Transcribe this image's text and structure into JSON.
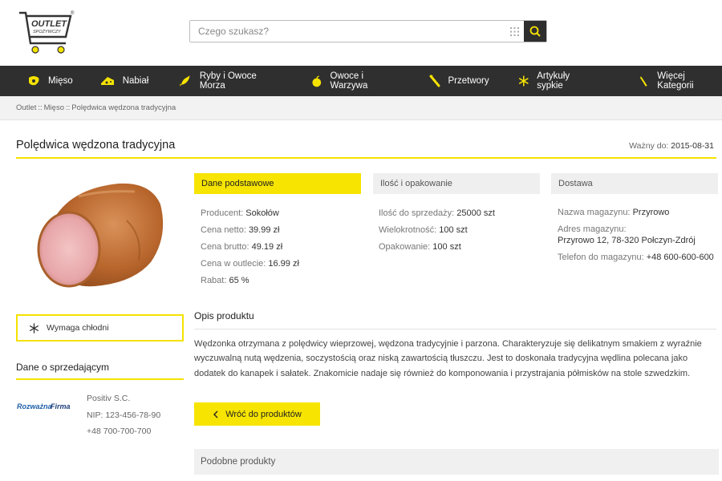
{
  "header": {
    "logo_line1": "OUTLET",
    "logo_line2": "SPOŻYWCZY",
    "logo_reg": "®",
    "search": {
      "placeholder": "Czego szukasz?"
    }
  },
  "nav": {
    "items": [
      {
        "label": "Mięso",
        "icon": "meat-icon"
      },
      {
        "label": "Nabiał",
        "icon": "cheese-icon"
      },
      {
        "label": "Ryby i Owoce Morza",
        "icon": "fish-icon"
      },
      {
        "label": "Owoce i Warzywa",
        "icon": "apple-icon"
      },
      {
        "label": "Przetwory",
        "icon": "jar-icon"
      },
      {
        "label": "Artykuły sypkie",
        "icon": "snowflake-icon"
      },
      {
        "label": "Więcej Kategorii",
        "icon": "more-icon"
      }
    ]
  },
  "breadcrumb": {
    "items": [
      "Outlet",
      "Mięso",
      "Polędwica wędzona tradycyjna"
    ],
    "separator": "::"
  },
  "product": {
    "title": "Polędwica wędzona tradycyjna",
    "valid_label": "Ważny do:",
    "valid_date": "2015-08-31"
  },
  "cards": {
    "basic": {
      "title": "Dane podstawowe",
      "rows": [
        {
          "label": "Producent:",
          "value": "Sokołów"
        },
        {
          "label": "Cena netto:",
          "value": "39.99 zł"
        },
        {
          "label": "Cena brutto:",
          "value": "49.19 zł"
        },
        {
          "label": "Cena w outlecie:",
          "value": "16.99 zł"
        },
        {
          "label": "Rabat:",
          "value": "65 %"
        }
      ]
    },
    "quantity": {
      "title": "Ilość i opakowanie",
      "rows": [
        {
          "label": "Ilość do sprzedaży:",
          "value": "25000 szt"
        },
        {
          "label": "Wielokrotność:",
          "value": "100 szt"
        },
        {
          "label": "Opakowanie:",
          "value": "100 szt"
        }
      ]
    },
    "delivery": {
      "title": "Dostawa",
      "warehouse_label": "Nazwa magazynu:",
      "warehouse_value": "Przyrowo",
      "address_label": "Adres magazynu:",
      "address_value": "Przyrowo 12, 78-320 Połczyn-Zdrój",
      "phone_label": "Telefon do magazynu:",
      "phone_value": "+48 600-600-600"
    }
  },
  "cold": {
    "label": "Wymaga chłodni"
  },
  "seller": {
    "heading": "Dane o sprzedającym",
    "logo_text_1": "Rozważna",
    "logo_text_2": "Firma",
    "name": "Positiv S.C.",
    "nip": "NIP: 123-456-78-90",
    "phone": "+48 700-700-700"
  },
  "description": {
    "heading": "Opis produktu",
    "text": "Wędzonka otrzymana z polędwicy wieprzowej, wędzona tradycyjnie i parzona. Charakteryzuje się delikatnym smakiem z wyraźnie wyczuwalną nutą wędzenia, soczystością oraz niską zawartością tłuszczu. Jest to doskonała tradycyjna wędlina polecana jako dodatek do kanapek i sałatek. Znakomicie nadaje się również do komponowania i przystrajania półmisków na stole szwedzkim."
  },
  "back_button": {
    "label": "Wróć do produktów"
  },
  "similar": {
    "heading": "Podobne produkty"
  },
  "colors": {
    "accent": "#f7e400",
    "nav_bg": "#2f2f2f"
  }
}
